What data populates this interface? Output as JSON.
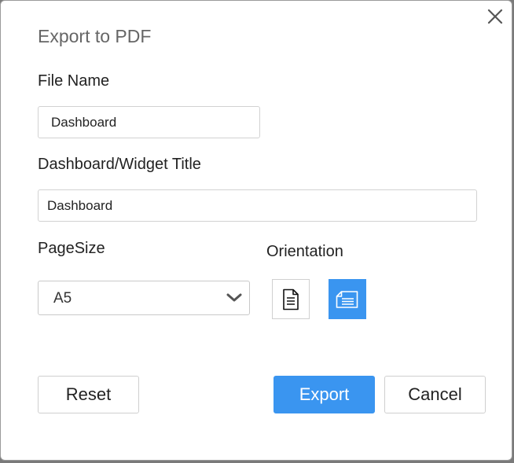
{
  "dialog": {
    "title": "Export to PDF",
    "close_icon": "close-icon"
  },
  "file_name": {
    "label": "File Name",
    "value": "Dashboard"
  },
  "widget_title": {
    "label": "Dashboard/Widget Title",
    "value": "Dashboard"
  },
  "page_size": {
    "label": "PageSize",
    "selected": "A5",
    "icon": "chevron-down-icon"
  },
  "orientation": {
    "label": "Orientation",
    "options": [
      {
        "name": "portrait",
        "icon": "portrait-page-icon",
        "selected": false
      },
      {
        "name": "landscape",
        "icon": "landscape-page-icon",
        "selected": true
      }
    ]
  },
  "buttons": {
    "reset": "Reset",
    "export": "Export",
    "cancel": "Cancel"
  },
  "colors": {
    "accent": "#3a95f0",
    "title_text": "#666666",
    "border": "#d2d2d2"
  }
}
